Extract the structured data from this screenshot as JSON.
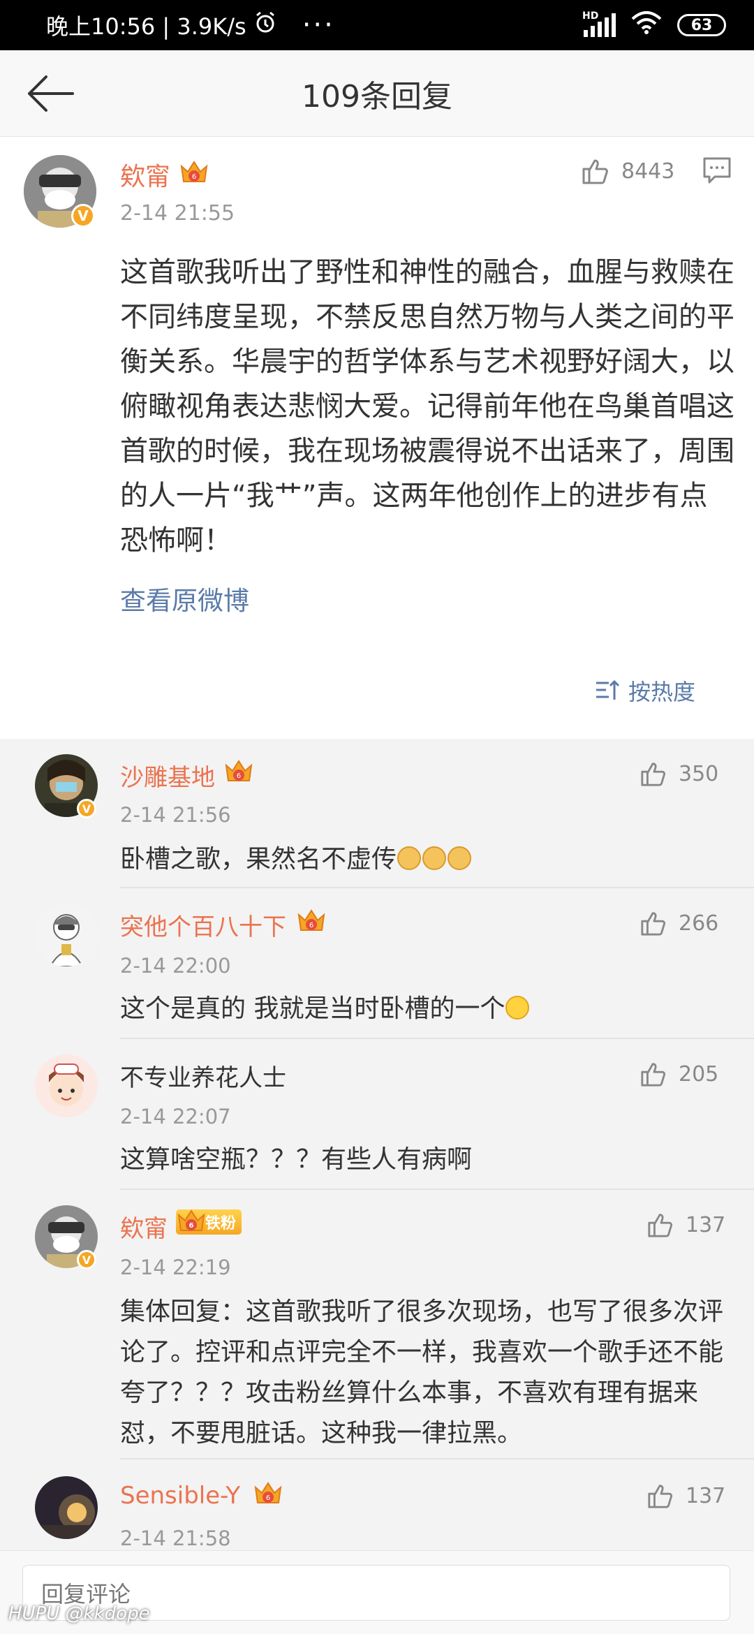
{
  "status_bar": {
    "time_speed": "晚上10:56 | 3.9K/s",
    "battery": "63",
    "network": "HD"
  },
  "header": {
    "title": "109条回复"
  },
  "main_comment": {
    "username": "欸甯",
    "time": "2-14 21:55",
    "likes": "8443",
    "text": "这首歌我听出了野性和神性的融合，血腥与救赎在不同纬度呈现，不禁反思自然万物与人类之间的平衡关系。华晨宇的哲学体系与艺术视野好阔大，以俯瞰视角表达悲悯大爱。记得前年他在鸟巢首唱这首歌的时候，我在现场被震得说不出话来了，周围的人一片“我艹”声。这两年他创作上的进步有点恐怖啊！",
    "view_original": "查看原微博",
    "sort_label": "按热度"
  },
  "replies": [
    {
      "username": "沙雕基地",
      "time": "2-14 21:56",
      "likes": "350",
      "text": "卧槽之歌，果然名不虚传"
    },
    {
      "username": "突他个百八十下",
      "time": "2-14 22:00",
      "likes": "266",
      "text": "这个是真的 我就是当时卧槽的一个"
    },
    {
      "username": "不专业养花人士",
      "time": "2-14 22:07",
      "likes": "205",
      "text": "这算啥空瓶？？？有些人有病啊"
    },
    {
      "username": "欸甯",
      "badge": "铁粉",
      "time": "2-14 22:19",
      "likes": "137",
      "text": "集体回复：这首歌我听了很多次现场，也写了很多次评论了。控评和点评完全不一样，我喜欢一个歌手还不能夸了？？？攻击粉丝算什么本事，不喜欢有理有据来怼，不要甩脏话。这种我一律拉黑。"
    },
    {
      "username": "Sensible-Y",
      "time": "2-14 21:58",
      "likes": "137",
      "text": ""
    }
  ],
  "bottom_bar": {
    "placeholder": "回复评论"
  },
  "watermark": "HUPU @kkdope",
  "colors": {
    "username": "#eb7350",
    "link": "#5b7ba8",
    "badge": "#f6a623"
  }
}
